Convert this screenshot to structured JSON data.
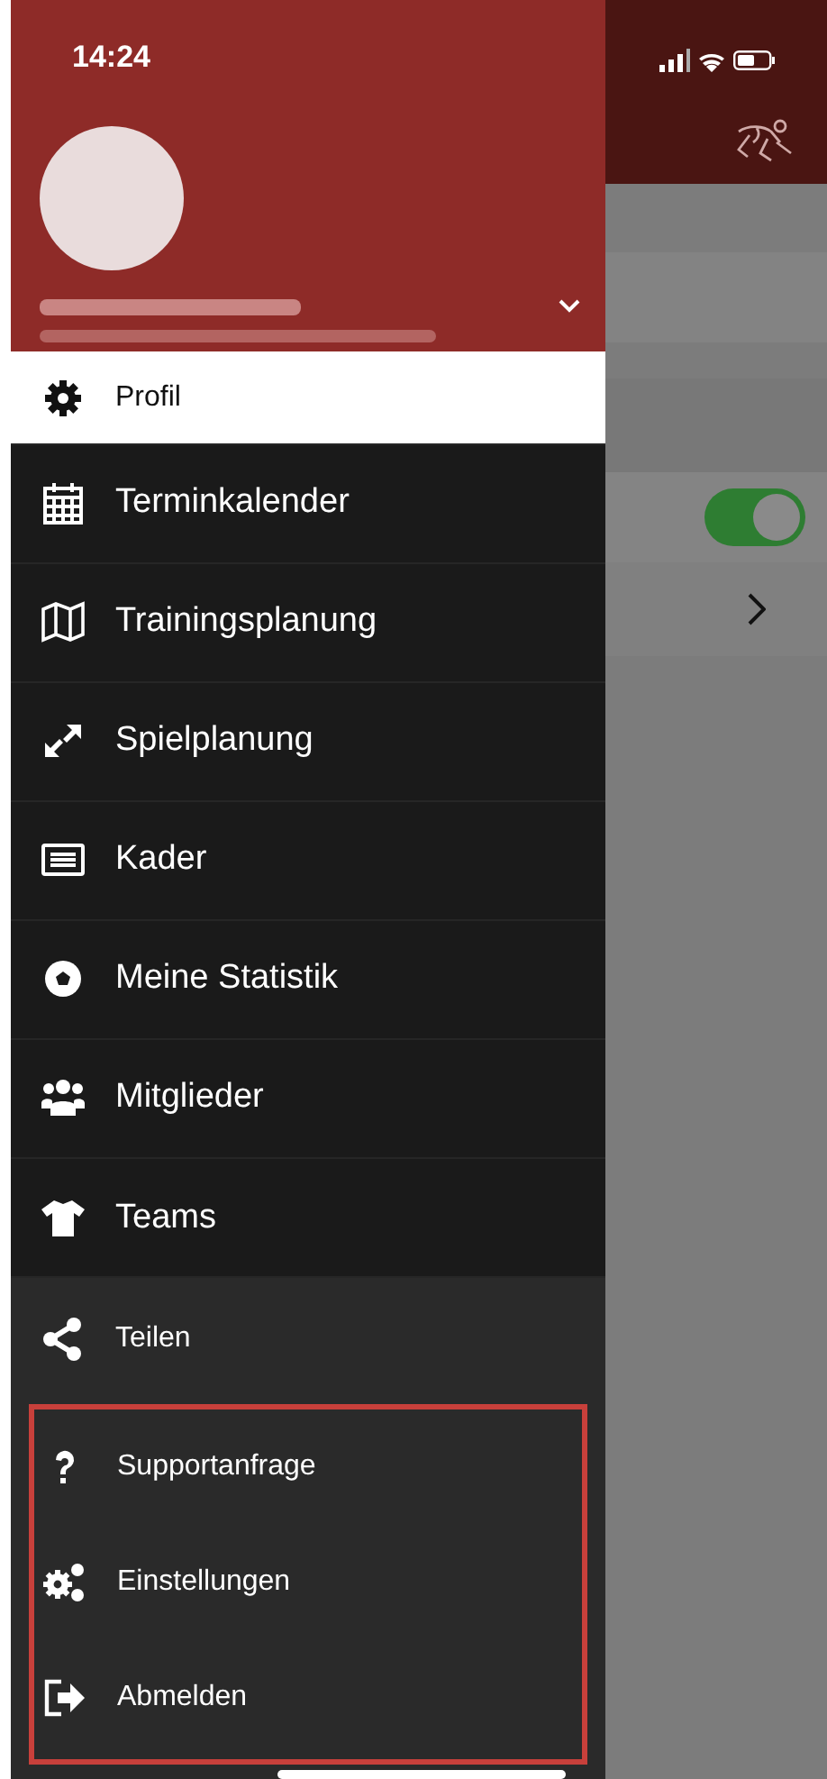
{
  "status_bar": {
    "time": "14:24"
  },
  "menu": [
    {
      "label": "Profil",
      "selected": true
    },
    {
      "label": "Terminkalender",
      "selected": false
    },
    {
      "label": "Trainingsplanung",
      "selected": false
    },
    {
      "label": "Spielplanung",
      "selected": false
    },
    {
      "label": "Kader",
      "selected": false
    },
    {
      "label": "Meine Statistik",
      "selected": false
    },
    {
      "label": "Mitglieder",
      "selected": false
    },
    {
      "label": "Teams",
      "selected": false
    }
  ],
  "secondary_menu": [
    {
      "label": "Teilen",
      "selected": false
    }
  ],
  "highlighted_menu": [
    {
      "label": "Supportanfrage",
      "selected": false
    },
    {
      "label": "Einstellungen",
      "selected": false
    },
    {
      "label": "Abmelden",
      "selected": false
    }
  ],
  "background": {
    "toggle": {
      "on": true
    }
  }
}
